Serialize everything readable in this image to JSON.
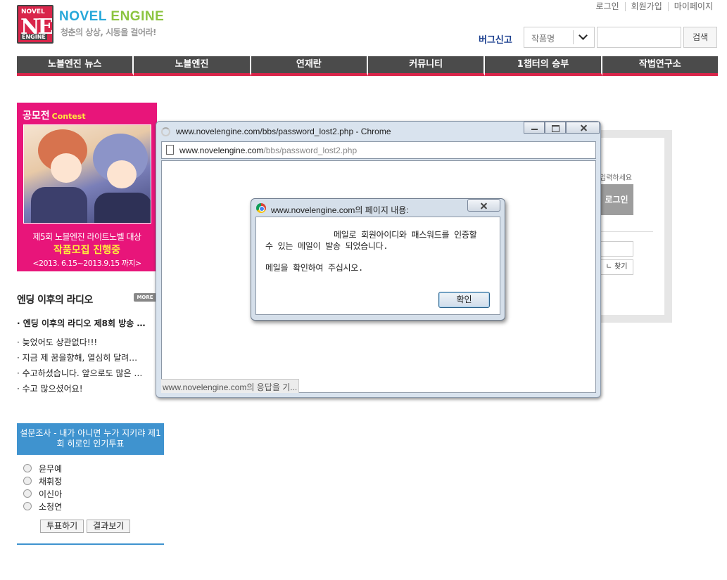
{
  "header": {
    "logo": {
      "line1": "NOVEL",
      "line2": "NE",
      "line3": "ENGINE"
    },
    "brand_name_part1": "NOVEL",
    "brand_name_part2": "ENGINE",
    "slogan": "청춘의 상상, 시동을 걸어라!",
    "top_links": [
      "로그인",
      "회원가입",
      "마이페이지"
    ],
    "bug_report": "버그신고",
    "search_select": "작품명",
    "search_button": "검색"
  },
  "nav": [
    "노블엔진 뉴스",
    "노블엔진",
    "연재란",
    "커뮤니티",
    "1챕터의 승부",
    "작법연구소"
  ],
  "contest": {
    "title": "공모전",
    "title_en": "Contest",
    "line1": "제5회 노블엔진 라이트노벨 대상",
    "line2": "작품모집 진행중",
    "line3": "<2013. 6.15~2013.9.15 까지>"
  },
  "radio": {
    "title": "엔딩 이후의 라디오",
    "more": "MORE",
    "items": [
      "· 엔딩 이후의 라디오 제8회 방송 …",
      "· 늦었어도 상관없다!!!",
      "· 지금 제 꿈을향해, 열심히 달려…",
      "· 수고하셨습니다. 앞으로도 많은 …",
      "· 수고 많으셨어요!"
    ]
  },
  "poll": {
    "title": "설문조사 - 내가 아니면 누가 지키랴 제1회 히로인 인기투표",
    "options": [
      "윤무예",
      "채휘정",
      "이신아",
      "소청연"
    ],
    "vote_button": "투표하기",
    "results_button": "결과보기"
  },
  "login_panel": {
    "hint": "입력하세요",
    "login_button": "로그인",
    "find_button": "ㄴ 찾기"
  },
  "chrome": {
    "title": "www.novelengine.com/bbs/password_lost2.php - Chrome",
    "address_domain": "www.novelengine.com",
    "address_path": "/bbs/password_lost2.php",
    "status": "www.novelengine.com의 응답을 기..."
  },
  "alert": {
    "title": "www.novelengine.com의 페이지 내용:",
    "message_line1a": "메일로 회원아이디와 패스워드를 인증할",
    "message_line1b": "수 있는 메일이 발송 되었습니다.",
    "message_line2": "메일을 확인하여 주십시오.",
    "ok_button": "확인"
  },
  "colors": {
    "brand_blue": "#27a8d9",
    "brand_green": "#8bc43f",
    "accent_pink": "#d9254a",
    "contest_pink": "#e8157a",
    "poll_blue": "#3f93cf"
  }
}
